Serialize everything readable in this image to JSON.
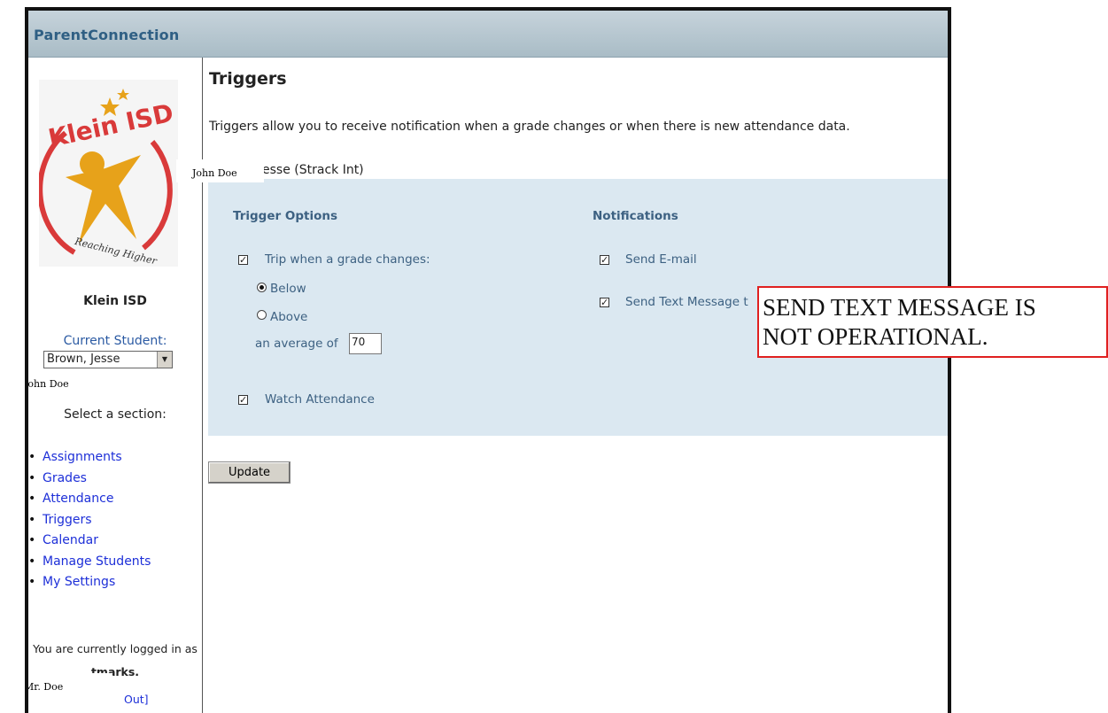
{
  "app": {
    "title": "ParentConnection"
  },
  "sidebar": {
    "district": "Klein ISD",
    "logo_text": "Klein ISD",
    "logo_tagline": "Reaching Higher",
    "current_student_label": "Current Student:",
    "student_selected": "Brown, Jesse",
    "redaction_top": "John Doe",
    "redaction_mid": "John Doe",
    "redaction_bottom": "Mr. Doe",
    "select_section_label": "Select a section:",
    "nav": [
      "Assignments",
      "Grades",
      "Attendance",
      "Triggers",
      "Calendar",
      "Manage Students",
      "My Settings"
    ],
    "logged_in_prefix": "You are currently logged in as",
    "username": "tmarks.",
    "logout_fragment": "Out]"
  },
  "main": {
    "title": "Triggers",
    "intro": "Triggers allow you to receive notification when a grade changes or when there is new attendance data.",
    "student_line": "esse (Strack Int)",
    "trigger_options": {
      "heading": "Trigger Options",
      "trip_label": "Trip when a grade changes:",
      "trip_checked": true,
      "below_label": "Below",
      "above_label": "Above",
      "selected": "Below",
      "average_label": "an average of",
      "average_value": "70",
      "watch_label": "Watch Attendance",
      "watch_checked": true
    },
    "notifications": {
      "heading": "Notifications",
      "email_label": "Send E-mail",
      "email_checked": true,
      "text_label": "Send Text Message t",
      "text_checked": true
    },
    "update_label": "Update"
  },
  "overlay_note": {
    "line1": "SEND TEXT MESSAGE IS",
    "line2": "NOT OPERATIONAL."
  },
  "colors": {
    "titlebar": "#b6c6cf",
    "panel": "#dbe8f1",
    "link": "#1d2fd8",
    "note_border": "#e02020"
  }
}
